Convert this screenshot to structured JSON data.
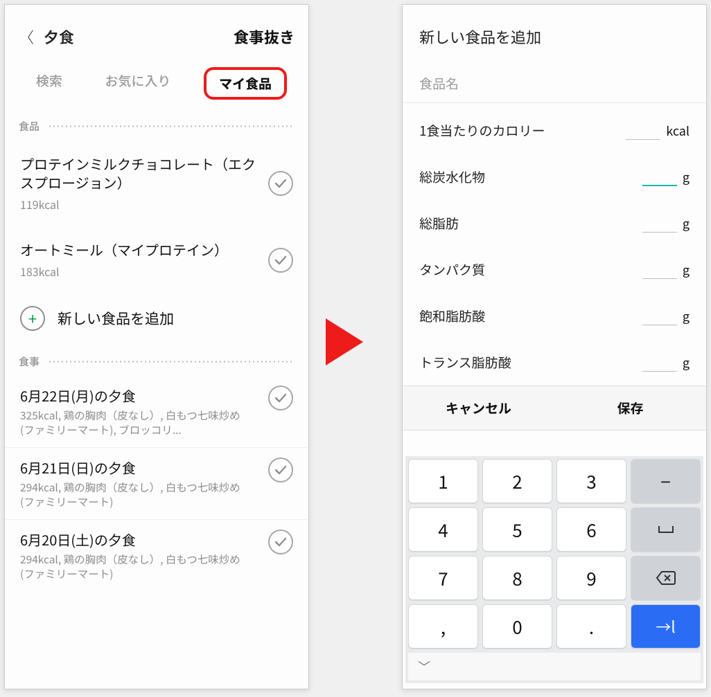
{
  "left": {
    "header": {
      "title": "夕食",
      "action": "食事抜き"
    },
    "tabs": [
      "検索",
      "お気に入り",
      "マイ食品"
    ],
    "activeTab": 2,
    "sectionFood": "食品",
    "foods": [
      {
        "name": "プロテインミルクチョコレート（エクスプロージョン）",
        "kcal": "119kcal"
      },
      {
        "name": "オートミール（マイプロテイン）",
        "kcal": "183kcal"
      }
    ],
    "addFood": "新しい食品を追加",
    "sectionMeal": "食事",
    "meals": [
      {
        "title": "6月22日(月)の夕食",
        "desc": "325kcal, 鶏の胸肉（皮なし）, 白もつ七味炒め(ファミリーマート), ブロッコリ..."
      },
      {
        "title": "6月21日(日)の夕食",
        "desc": "294kcal, 鶏の胸肉（皮なし）, 白もつ七味炒め(ファミリーマート)"
      },
      {
        "title": "6月20日(土)の夕食",
        "desc": "294kcal, 鶏の胸肉（皮なし）, 白もつ七味炒め(ファミリーマート)"
      }
    ]
  },
  "right": {
    "title": "新しい食品を追加",
    "namePlaceholder": "食品名",
    "rows": [
      {
        "label": "1食当たりのカロリー",
        "unit": "kcal",
        "focused": false
      },
      {
        "label": "総炭水化物",
        "unit": "g",
        "focused": true
      },
      {
        "label": "総脂肪",
        "unit": "g",
        "focused": false
      },
      {
        "label": "タンパク質",
        "unit": "g",
        "focused": false
      },
      {
        "label": "飽和脂肪酸",
        "unit": "g",
        "focused": false
      },
      {
        "label": "トランス脂肪酸",
        "unit": "g",
        "focused": false
      }
    ],
    "actions": {
      "cancel": "キャンセル",
      "save": "保存"
    },
    "keypad": [
      [
        "1",
        "2",
        "3",
        "−"
      ],
      [
        "4",
        "5",
        "6",
        "␣"
      ],
      [
        "7",
        "8",
        "9",
        "⌫"
      ],
      [
        ",",
        "0",
        ".",
        "→"
      ]
    ]
  }
}
